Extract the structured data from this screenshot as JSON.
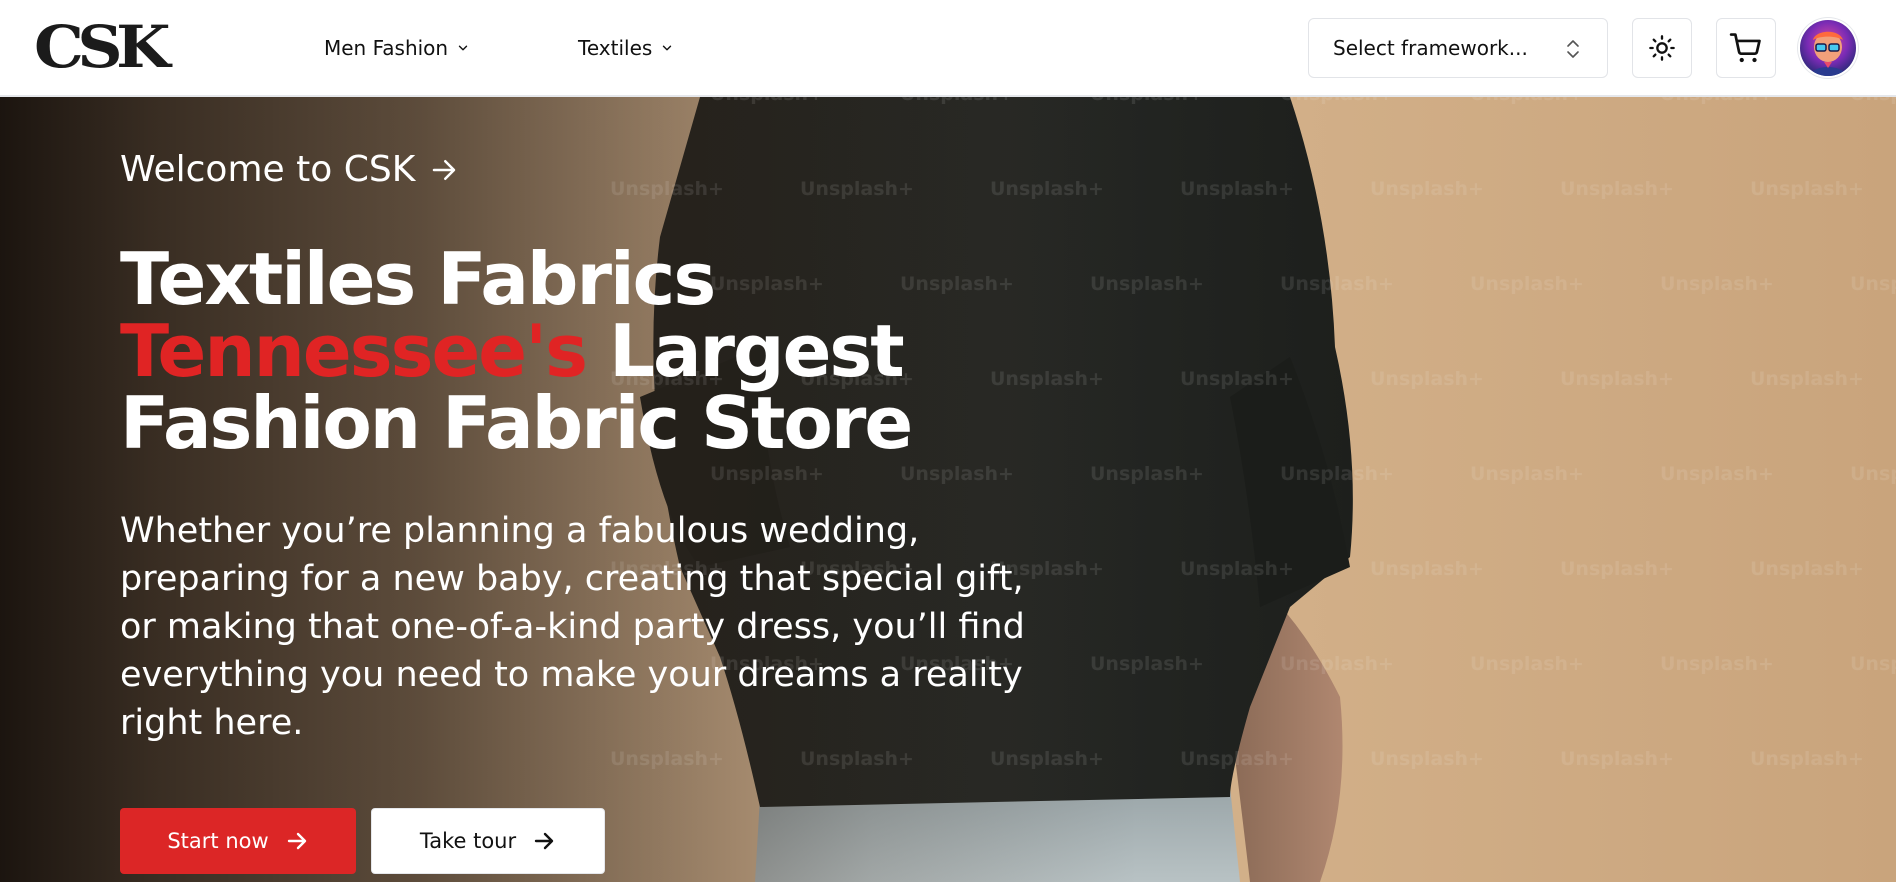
{
  "header": {
    "logo_text": "CSK",
    "nav": [
      {
        "label": "Men Fashion",
        "icon": "chevron-down-icon"
      },
      {
        "label": "Textiles",
        "icon": "chevron-down-icon"
      }
    ],
    "framework_select": {
      "value": "Select framework...",
      "icon": "chevrons-up-down-icon"
    },
    "theme_toggle_icon": "sun-icon",
    "cart_icon": "shopping-cart-icon",
    "avatar": "user-avatar"
  },
  "hero": {
    "welcome_text": "Welcome to CSK",
    "headline": {
      "line1": "Textiles Fabrics",
      "line2_highlight": "Tennessee's",
      "line2_rest": " Largest",
      "line3": "Fashion Fabric Store"
    },
    "description": "Whether you’re planning a fabulous wedding, preparing for a new baby, creating that special gift, or making that one-of-a-kind party dress, you’ll find everything you need to make your dreams a reality right here.",
    "watermark": "Unsplash+",
    "primary_button": "Start now",
    "secondary_button": "Take tour"
  },
  "colors": {
    "accent_red": "#e02424",
    "button_red": "#dc2626",
    "text_dark": "#111111",
    "background_beige": "#d6b58f"
  }
}
